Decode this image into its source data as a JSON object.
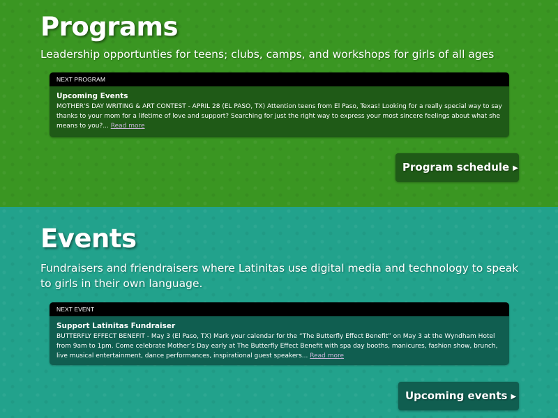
{
  "programs": {
    "title": "Programs",
    "subtitle": "Leadership opportunties for teens; clubs, camps, and workshops for girls of all ages",
    "card": {
      "header": "NEXT PROGRAM",
      "title": "Upcoming Events",
      "text": "MOTHER'S DAY WRITING & ART CONTEST - APRIL 28 (EL PASO, TX) Attention teens from El Paso, Texas! Looking for a really special way to say thanks to your mom for a lifetime of love and support? Searching for just the right way to express your most sincere feelings about what she means to you?... ",
      "read_more": "Read more"
    },
    "button": {
      "label": "Program schedule",
      "icon": "▶"
    },
    "colors": {
      "background": "#3a9622",
      "card": "#1f5a17"
    }
  },
  "events": {
    "title": "Events",
    "subtitle": "Fundraisers and friendraisers where Latinitas use digital media and technology to speak to girls in their own language.",
    "card": {
      "header": "NEXT EVENT",
      "title": "Support Latinitas Fundraiser",
      "text": "BUTTERFLY EFFECT BENEFIT - May 3 (El Paso, TX) Mark your calendar for the “The Butterfly Effect Benefit” on May 3 at the Wyndham Hotel from 9am to 1pm. Come celebrate Mother’s Day early at The Butterfly Effect Benefit with spa day booths, manicures, fashion show, brunch, live musical entertainment, dance performances, inspirational guest speakers... ",
      "read_more": "Read more"
    },
    "button": {
      "label": "Upcoming events",
      "icon": "▶"
    },
    "colors": {
      "background": "#22a28c",
      "card": "#105e50"
    }
  }
}
